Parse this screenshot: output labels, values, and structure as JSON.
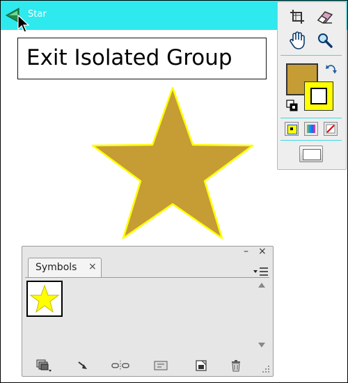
{
  "isolation_bar": {
    "label": "Star",
    "background": "#2ee9ee",
    "back_icon": "green-back-arrow-icon"
  },
  "tooltip": {
    "text": "Exit Isolated Group"
  },
  "artwork": {
    "shape": "star",
    "fill": "#c69c35",
    "stroke": "#ffff00"
  },
  "tools_panel": {
    "tools": [
      "artboard-crop-icon",
      "eraser-icon",
      "hand-icon",
      "zoom-icon"
    ],
    "fill_color": "#c69c35",
    "stroke_color": "#ffff00",
    "modes": [
      "color-mode-icon",
      "gradient-mode-icon",
      "none-mode-icon"
    ],
    "screen_mode_icon": "screen-mode-icon"
  },
  "symbols_panel": {
    "tab_label": "Symbols",
    "tab_close": "×",
    "minimize": "–",
    "close": "×",
    "symbols": [
      {
        "icon": "yellow-star-icon",
        "color": "#ffff00"
      }
    ],
    "bottom_buttons": [
      "symbol-libraries-icon",
      "place-symbol-icon",
      "break-link-icon",
      "symbol-options-icon",
      "new-symbol-icon",
      "delete-symbol-icon"
    ]
  }
}
